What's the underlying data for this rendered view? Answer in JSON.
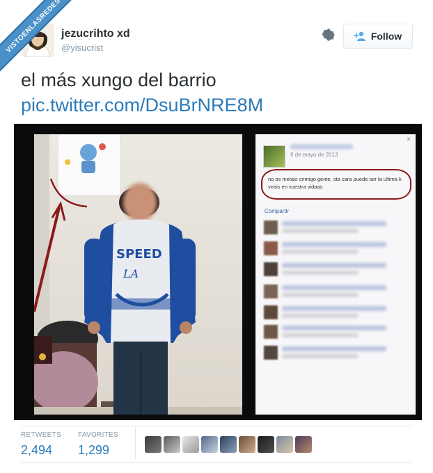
{
  "watermark": {
    "text": "VISTOENLASREDES"
  },
  "author": {
    "name": "jezucrihto xd",
    "handle": "@yisucrist"
  },
  "actions": {
    "follow_label": "Follow"
  },
  "tweet": {
    "text": "el más xungo del barrio",
    "link": "pic.twitter.com/DsuBrNRE8M"
  },
  "embedded_post": {
    "date": "9 de mayo de 2013",
    "message": "no os metais cnmigo gente, sta cara puede ser la ultima k veais en vuestra vidaas",
    "share_label": "Compartir",
    "close": "×"
  },
  "stats": {
    "retweets_label": "RETWEETS",
    "retweets_value": "2,494",
    "favorites_label": "FAVORITES",
    "favorites_value": "1,299"
  },
  "colors": {
    "link": "#2b7bb9",
    "text": "#292f33",
    "muted": "#8899a6",
    "accent": "#55acee",
    "ribbon": "#4a90c9",
    "annotation": "#8b1a1a"
  },
  "favoriters_count_shown": 9
}
